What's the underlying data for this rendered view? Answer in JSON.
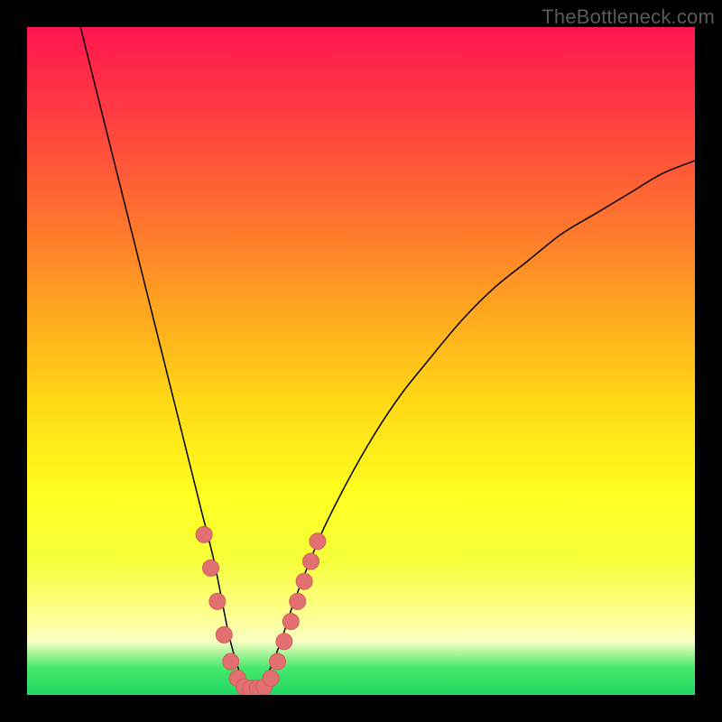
{
  "watermark_text": "TheBottleneck.com",
  "chart_data": {
    "type": "line",
    "title": "",
    "xlabel": "",
    "ylabel": "",
    "xlim": [
      0,
      100
    ],
    "ylim": [
      0,
      100
    ],
    "series": [
      {
        "name": "bottleneck-curve",
        "x": [
          8,
          10,
          12,
          14,
          16,
          18,
          20,
          22,
          24,
          26,
          28,
          30,
          31,
          32,
          33,
          34,
          35,
          36,
          38,
          40,
          44,
          48,
          52,
          56,
          60,
          65,
          70,
          75,
          80,
          85,
          90,
          95,
          100
        ],
        "y": [
          100,
          92,
          84,
          76,
          68,
          60,
          52,
          44,
          36,
          28,
          20,
          10,
          6,
          3,
          1.5,
          1,
          1.5,
          3,
          8,
          14,
          24,
          32,
          39,
          45,
          50,
          56,
          61,
          65,
          69,
          72,
          75,
          78,
          80
        ]
      }
    ],
    "markers": {
      "name": "highlighted-points",
      "x": [
        26.5,
        27.5,
        28.5,
        29.5,
        30.5,
        31.5,
        32.5,
        33.5,
        34.5,
        35.5,
        36.5,
        37.5,
        38.5,
        39.5,
        40.5,
        41.5,
        42.5,
        43.5
      ],
      "y": [
        24,
        19,
        14,
        9,
        5,
        2.5,
        1.2,
        1,
        1,
        1.2,
        2.5,
        5,
        8,
        11,
        14,
        17,
        20,
        23
      ]
    },
    "gradient_stops": [
      {
        "pos": 0.0,
        "color": "#ff1650"
      },
      {
        "pos": 0.14,
        "color": "#ff4040"
      },
      {
        "pos": 0.28,
        "color": "#ff7030"
      },
      {
        "pos": 0.42,
        "color": "#ffa520"
      },
      {
        "pos": 0.56,
        "color": "#ffd815"
      },
      {
        "pos": 0.7,
        "color": "#ffff20"
      },
      {
        "pos": 0.8,
        "color": "#f5ff3a"
      },
      {
        "pos": 0.88,
        "color": "#ffff90"
      },
      {
        "pos": 0.92,
        "color": "#f8ffc0"
      },
      {
        "pos": 0.96,
        "color": "#44e86a"
      },
      {
        "pos": 1.0,
        "color": "#1fd860"
      }
    ]
  }
}
